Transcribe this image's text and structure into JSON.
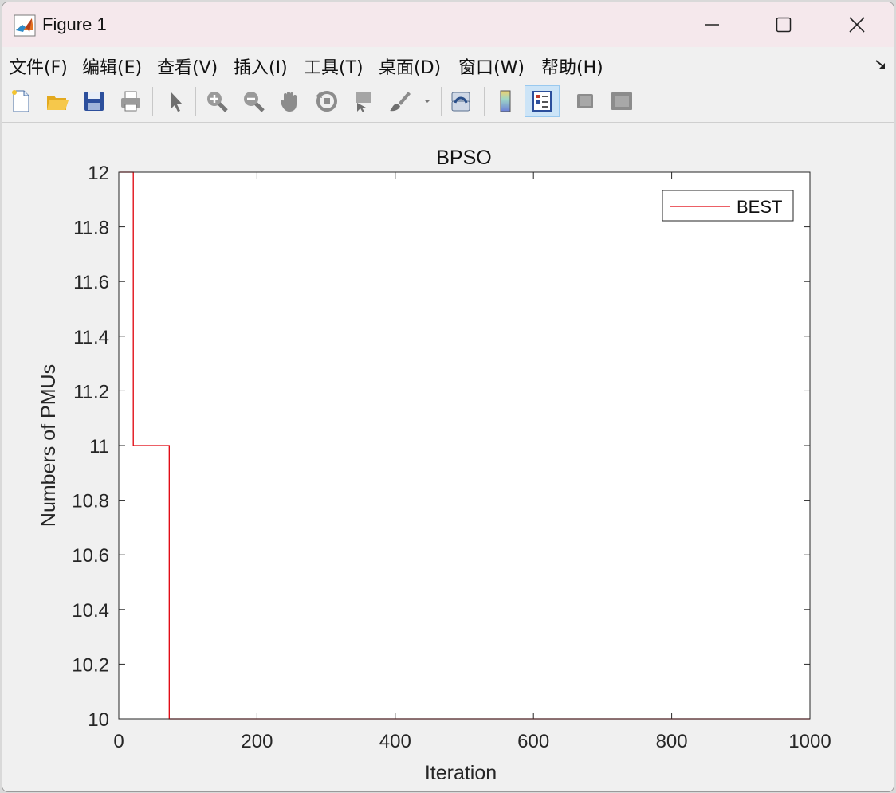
{
  "window": {
    "title": "Figure 1",
    "controls": {
      "minimize": "minimize",
      "maximize": "maximize",
      "close": "close"
    }
  },
  "menu": {
    "items": [
      {
        "label": "文件(F)",
        "name": "menu-file"
      },
      {
        "label": "编辑(E)",
        "name": "menu-edit"
      },
      {
        "label": "查看(V)",
        "name": "menu-view"
      },
      {
        "label": "插入(I)",
        "name": "menu-insert"
      },
      {
        "label": "工具(T)",
        "name": "menu-tools"
      },
      {
        "label": "桌面(D)",
        "name": "menu-desktop"
      },
      {
        "label": "窗口(W)",
        "name": "menu-window"
      },
      {
        "label": "帮助(H)",
        "name": "menu-help"
      }
    ]
  },
  "toolbar": {
    "icons": [
      "new-figure-icon",
      "open-folder-icon",
      "save-icon",
      "print-icon",
      "pointer-icon",
      "zoom-in-icon",
      "zoom-out-icon",
      "pan-hand-icon",
      "rotate-3d-icon",
      "data-cursor-icon",
      "brush-icon",
      "link-plot-icon",
      "colorbar-icon",
      "legend-icon",
      "hide-plot-tools-icon",
      "show-plot-tools-icon"
    ],
    "active": "legend-icon"
  },
  "colors": {
    "line": "#e0000a",
    "axes": "#262626",
    "title_bar": "#f5e8ec"
  },
  "chart_data": {
    "type": "line",
    "title": "BPSO",
    "xlabel": "Iteration",
    "ylabel": "Numbers of PMUs",
    "xlim": [
      0,
      1000
    ],
    "ylim": [
      10,
      12
    ],
    "xticks": [
      "0",
      "200",
      "400",
      "600",
      "800",
      "1000"
    ],
    "yticks": [
      "10",
      "10.2",
      "10.4",
      "10.6",
      "10.8",
      "11",
      "11.2",
      "11.4",
      "11.6",
      "11.8",
      "12"
    ],
    "grid": false,
    "legend_position": "top-right",
    "series": [
      {
        "name": "BEST",
        "color": "#e0000a",
        "step": true,
        "x": [
          1,
          21,
          21,
          73,
          73,
          1000
        ],
        "y": [
          12,
          12,
          11,
          11,
          10,
          10
        ]
      }
    ]
  }
}
